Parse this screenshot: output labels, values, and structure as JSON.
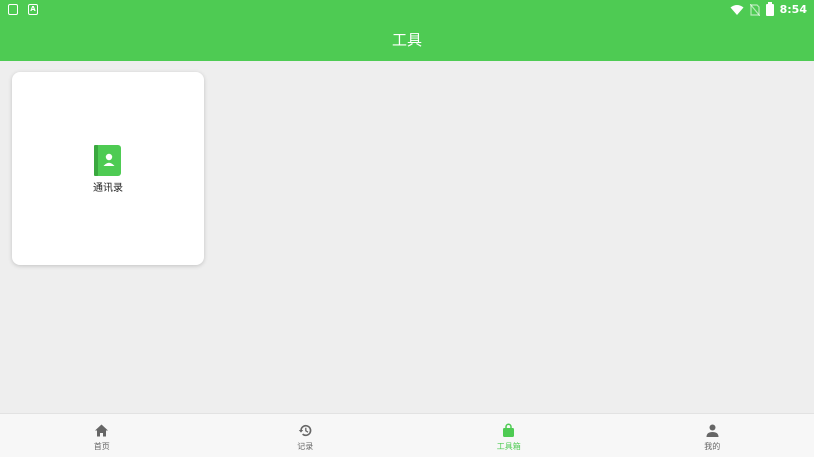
{
  "status_bar": {
    "time": "8:54"
  },
  "app_bar": {
    "title": "工具"
  },
  "tools": [
    {
      "label": "通讯录",
      "icon": "contacts-book-icon"
    }
  ],
  "bottom_nav": [
    {
      "label": "首页",
      "icon": "home-icon"
    },
    {
      "label": "记录",
      "icon": "history-icon"
    },
    {
      "label": "工具箱",
      "icon": "shopping-bag-icon",
      "active": true
    },
    {
      "label": "我的",
      "icon": "person-icon"
    }
  ],
  "colors": {
    "primary": "#4ecb53",
    "background": "#eeeeee",
    "card": "#ffffff"
  }
}
